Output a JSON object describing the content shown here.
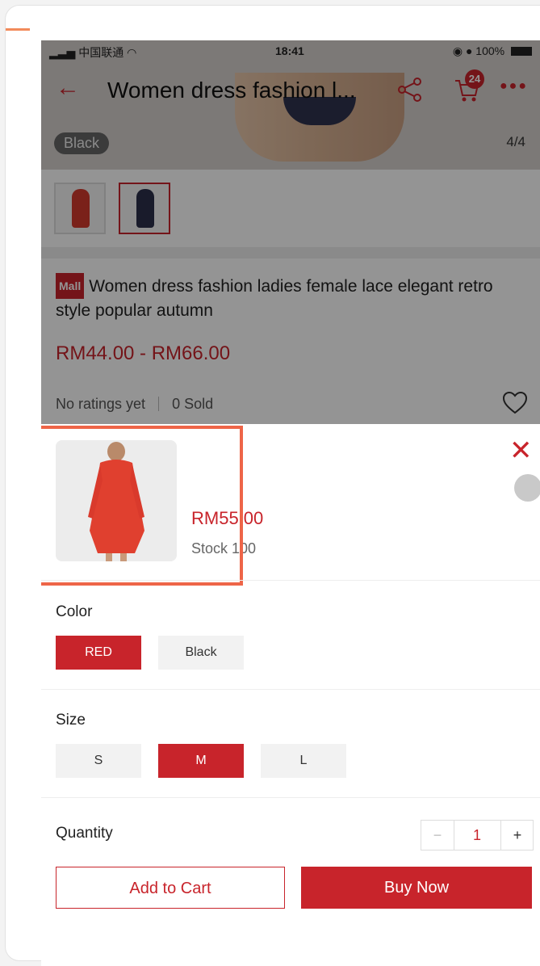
{
  "status_bar": {
    "carrier": "中国联通",
    "time": "18:41",
    "battery": "100%"
  },
  "nav": {
    "title": "Women dress fashion l...",
    "cart_badge": "24"
  },
  "gallery": {
    "color_chip": "Black",
    "image_counter": "4/4"
  },
  "product": {
    "mall_badge": "Mall",
    "title": "Women dress fashion ladies female lace elegant retro style popular autumn",
    "price_range": "RM44.00 - RM66.00",
    "ratings": "No ratings yet",
    "sold": "0 Sold"
  },
  "sheet": {
    "price": "RM55.00",
    "stock": "Stock 100",
    "color_label": "Color",
    "colors": [
      "RED",
      "Black"
    ],
    "size_label": "Size",
    "sizes": [
      "S",
      "M",
      "L"
    ],
    "quantity_label": "Quantity",
    "quantity_minus": "−",
    "quantity_value": "1",
    "quantity_plus": "+",
    "add_to_cart": "Add to Cart",
    "buy_now": "Buy Now"
  },
  "colors": {
    "brand_red": "#c8242b",
    "highlight": "#ee6548"
  }
}
